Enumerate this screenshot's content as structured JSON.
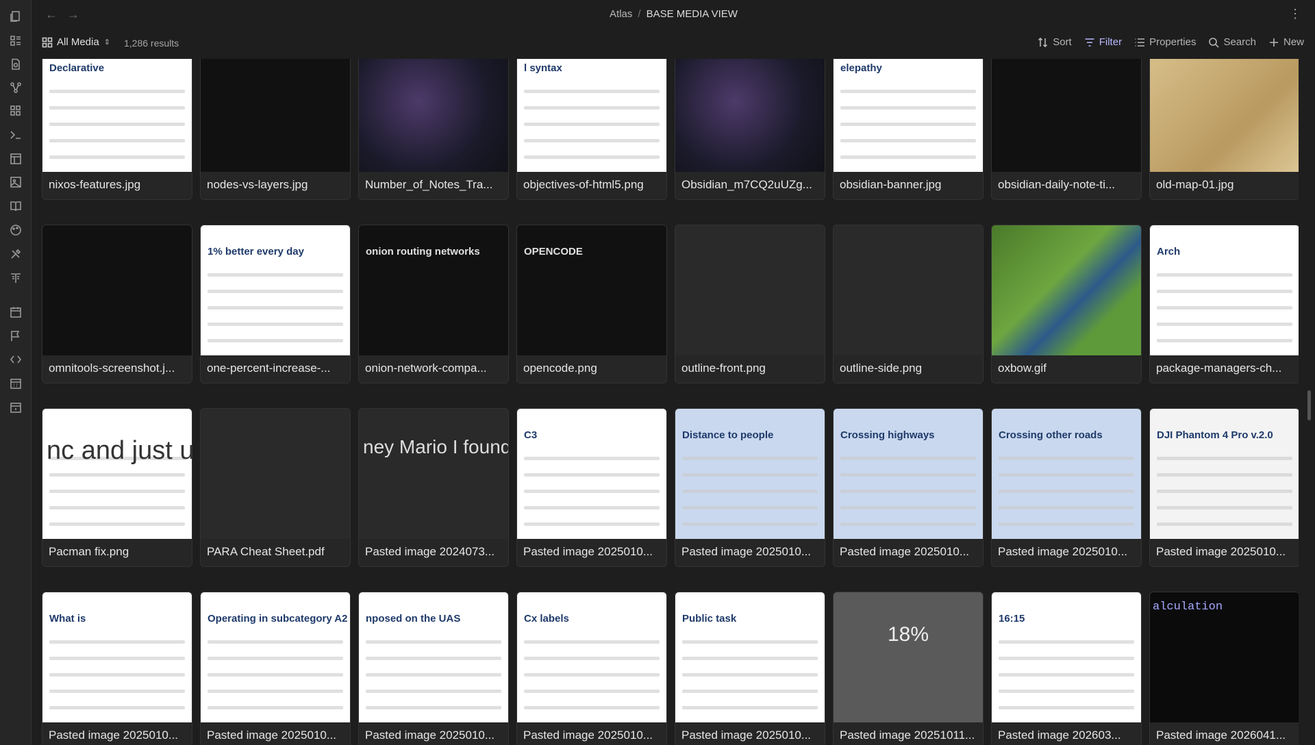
{
  "title": {
    "vault": "Atlas",
    "separator": "/",
    "view": "BASE MEDIA VIEW"
  },
  "toolbar": {
    "view_name": "All Media",
    "result_count": "1,286 results",
    "sort": "Sort",
    "filter": "Filter",
    "properties": "Properties",
    "search": "Search",
    "new": "New"
  },
  "colors": {
    "accent": "#b9b9ff",
    "background": "#1e1e1e"
  },
  "ribbon_icons": [
    "files-icon",
    "list-icon",
    "file-search-icon",
    "graph-icon",
    "blocks-icon",
    "terminal-icon",
    "layout-icon",
    "image-icon",
    "book-icon",
    "palette-icon",
    "tools-icon",
    "book-open-icon",
    "calendar-icon",
    "flag-icon",
    "code-percent-icon",
    "calendar-grid-icon",
    "calendar-day-icon"
  ],
  "cards": [
    {
      "name": "nixos-features.jpg",
      "thumb": "white",
      "text": "Declarative"
    },
    {
      "name": "nodes-vs-layers.jpg",
      "thumb": "dark",
      "text": ""
    },
    {
      "name": "Number_of_Notes_Tra...",
      "thumb": "dots",
      "text": ""
    },
    {
      "name": "objectives-of-html5.png",
      "thumb": "white",
      "text": "l syntax"
    },
    {
      "name": "Obsidian_m7CQ2uUZg...",
      "thumb": "dots",
      "text": ""
    },
    {
      "name": "obsidian-banner.jpg",
      "thumb": "white",
      "text": "elepathy"
    },
    {
      "name": "obsidian-daily-note-ti...",
      "thumb": "dark",
      "text": ""
    },
    {
      "name": "old-map-01.jpg",
      "thumb": "map",
      "text": ""
    },
    {
      "name": "omnitools-screenshot.j...",
      "thumb": "dark",
      "text": ""
    },
    {
      "name": "one-percent-increase-...",
      "thumb": "white",
      "text": "1% better every day"
    },
    {
      "name": "onion-network-compa...",
      "thumb": "dark",
      "text": "onion routing networks"
    },
    {
      "name": "opencode.png",
      "thumb": "dark",
      "text": "OPENCODE"
    },
    {
      "name": "outline-front.png",
      "thumb": "grey",
      "text": ""
    },
    {
      "name": "outline-side.png",
      "thumb": "grey",
      "text": ""
    },
    {
      "name": "oxbow.gif",
      "thumb": "green",
      "text": ""
    },
    {
      "name": "package-managers-ch...",
      "thumb": "white",
      "text": "Arch"
    },
    {
      "name": "Pacman fix.png",
      "thumb": "white",
      "text": "nc and just u"
    },
    {
      "name": "PARA Cheat Sheet.pdf",
      "thumb": "grey",
      "text": ""
    },
    {
      "name": "Pasted image 2024073...",
      "thumb": "grey",
      "text": "ney Mario I found in"
    },
    {
      "name": "Pasted image 2025010...",
      "thumb": "white",
      "text": "C3"
    },
    {
      "name": "Pasted image 2025010...",
      "thumb": "blue",
      "text": "Distance to people"
    },
    {
      "name": "Pasted image 2025010...",
      "thumb": "blue",
      "text": "Crossing highways"
    },
    {
      "name": "Pasted image 2025010...",
      "thumb": "blue",
      "text": "Crossing other roads"
    },
    {
      "name": "Pasted image 2025010...",
      "thumb": "pink",
      "text": "DJI Phantom 4 Pro v.2.0"
    },
    {
      "name": "Pasted image 2025010...",
      "thumb": "white",
      "text": "What is"
    },
    {
      "name": "Pasted image 2025010...",
      "thumb": "white",
      "text": "Operating in subcategory A2"
    },
    {
      "name": "Pasted image 2025010...",
      "thumb": "white",
      "text": "nposed on the UAS"
    },
    {
      "name": "Pasted image 2025010...",
      "thumb": "white",
      "text": "Cx labels"
    },
    {
      "name": "Pasted image 2025010...",
      "thumb": "white",
      "text": "Public task"
    },
    {
      "name": "Pasted image 20251011...",
      "thumb": "percent",
      "text": "18%"
    },
    {
      "name": "Pasted image 202603...",
      "thumb": "white",
      "text": "16:15"
    },
    {
      "name": "Pasted image 2026041...",
      "thumb": "black",
      "text": "alculation"
    }
  ]
}
